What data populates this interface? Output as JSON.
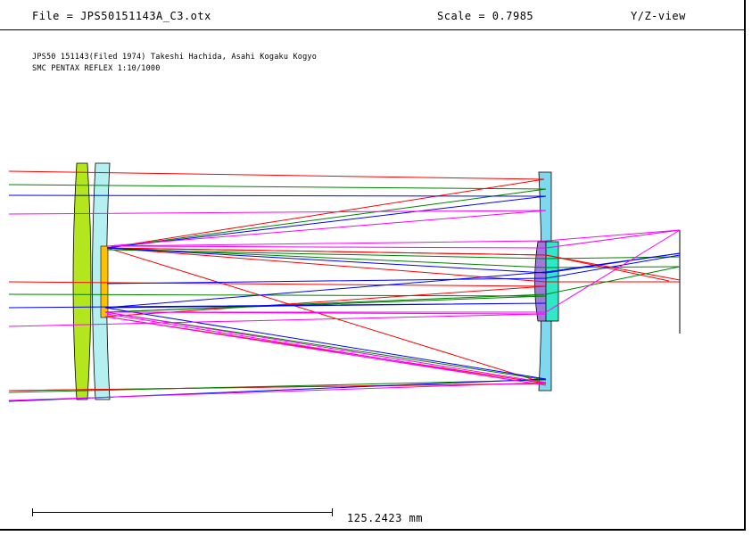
{
  "header": {
    "file_label": "File = JPS50151143A_C3.otx",
    "scale_label": "Scale = 0.7985",
    "view_label": "Y/Z-view"
  },
  "description": {
    "line1": "JPS50 151143(Filed 1974) Takeshi Hachida, Asahi Kogaku Kogyo",
    "line2": "SMC PENTAX REFLEX 1:10/1000"
  },
  "scale_bar": {
    "label": "125.2423 mm"
  },
  "colors": {
    "ray_red": "#ff0000",
    "ray_green": "#008000",
    "ray_blue": "#0000ff",
    "ray_magenta": "#ff00ff",
    "corrector_lens": "#b4e61e",
    "meniscus_lens": "#b4f0f0",
    "secondary_mirror": "#ffc000",
    "primary_mirror": "#80d8f0",
    "relay_lens_1": "#9c7cd8",
    "relay_lens_2": "#30e8c8"
  }
}
